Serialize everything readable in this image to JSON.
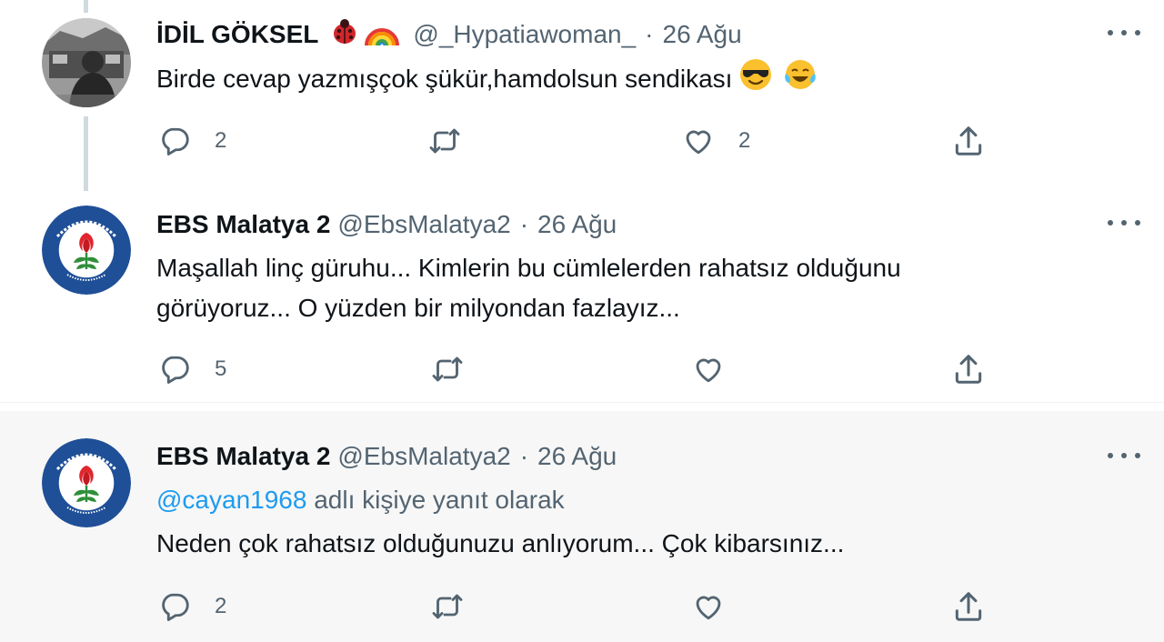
{
  "tweets": [
    {
      "name": "İDİL GÖKSEL",
      "handle": "@_Hypatiawoman_",
      "separator": "·",
      "date": "26 Ağu",
      "text": "Birde cevap yazmışçok şükür,hamdolsun sendikası",
      "name_emojis": [
        "ladybug-emoji",
        "rainbow-emoji"
      ],
      "text_emojis": [
        "sunglasses-face-emoji",
        "tears-of-joy-emoji"
      ],
      "reply_count": "2",
      "retweet_count": "",
      "like_count": "2"
    },
    {
      "name": "EBS Malatya 2",
      "handle": "@EbsMalatya2",
      "separator": "·",
      "date": "26 Ağu",
      "text_line1": "Maşallah linç güruhu... Kimlerin bu cümlelerden rahatsız olduğunu",
      "text_line2": "görüyoruz... O yüzden bir milyondan fazlayız...",
      "reply_count": "5",
      "retweet_count": "",
      "like_count": ""
    },
    {
      "name": "EBS Malatya 2",
      "handle": "@EbsMalatya2",
      "separator": "·",
      "date": "26 Ağu",
      "reply_to_mention": "@cayan1968",
      "reply_to_suffix": " adlı kişiye yanıt olarak",
      "text": "Neden çok rahatsız olduğunuzu anlıyorum... Çok kibarsınız...",
      "reply_count": "2",
      "retweet_count": "",
      "like_count": ""
    }
  ],
  "colors": {
    "text": "#0f1419",
    "secondary": "#536471",
    "link": "#1d9bf0",
    "thread_line": "#cfd9de",
    "highlight_bg": "#f7f7f7"
  },
  "icons": [
    "reply-icon",
    "retweet-icon",
    "like-icon",
    "share-icon",
    "more-icon"
  ]
}
